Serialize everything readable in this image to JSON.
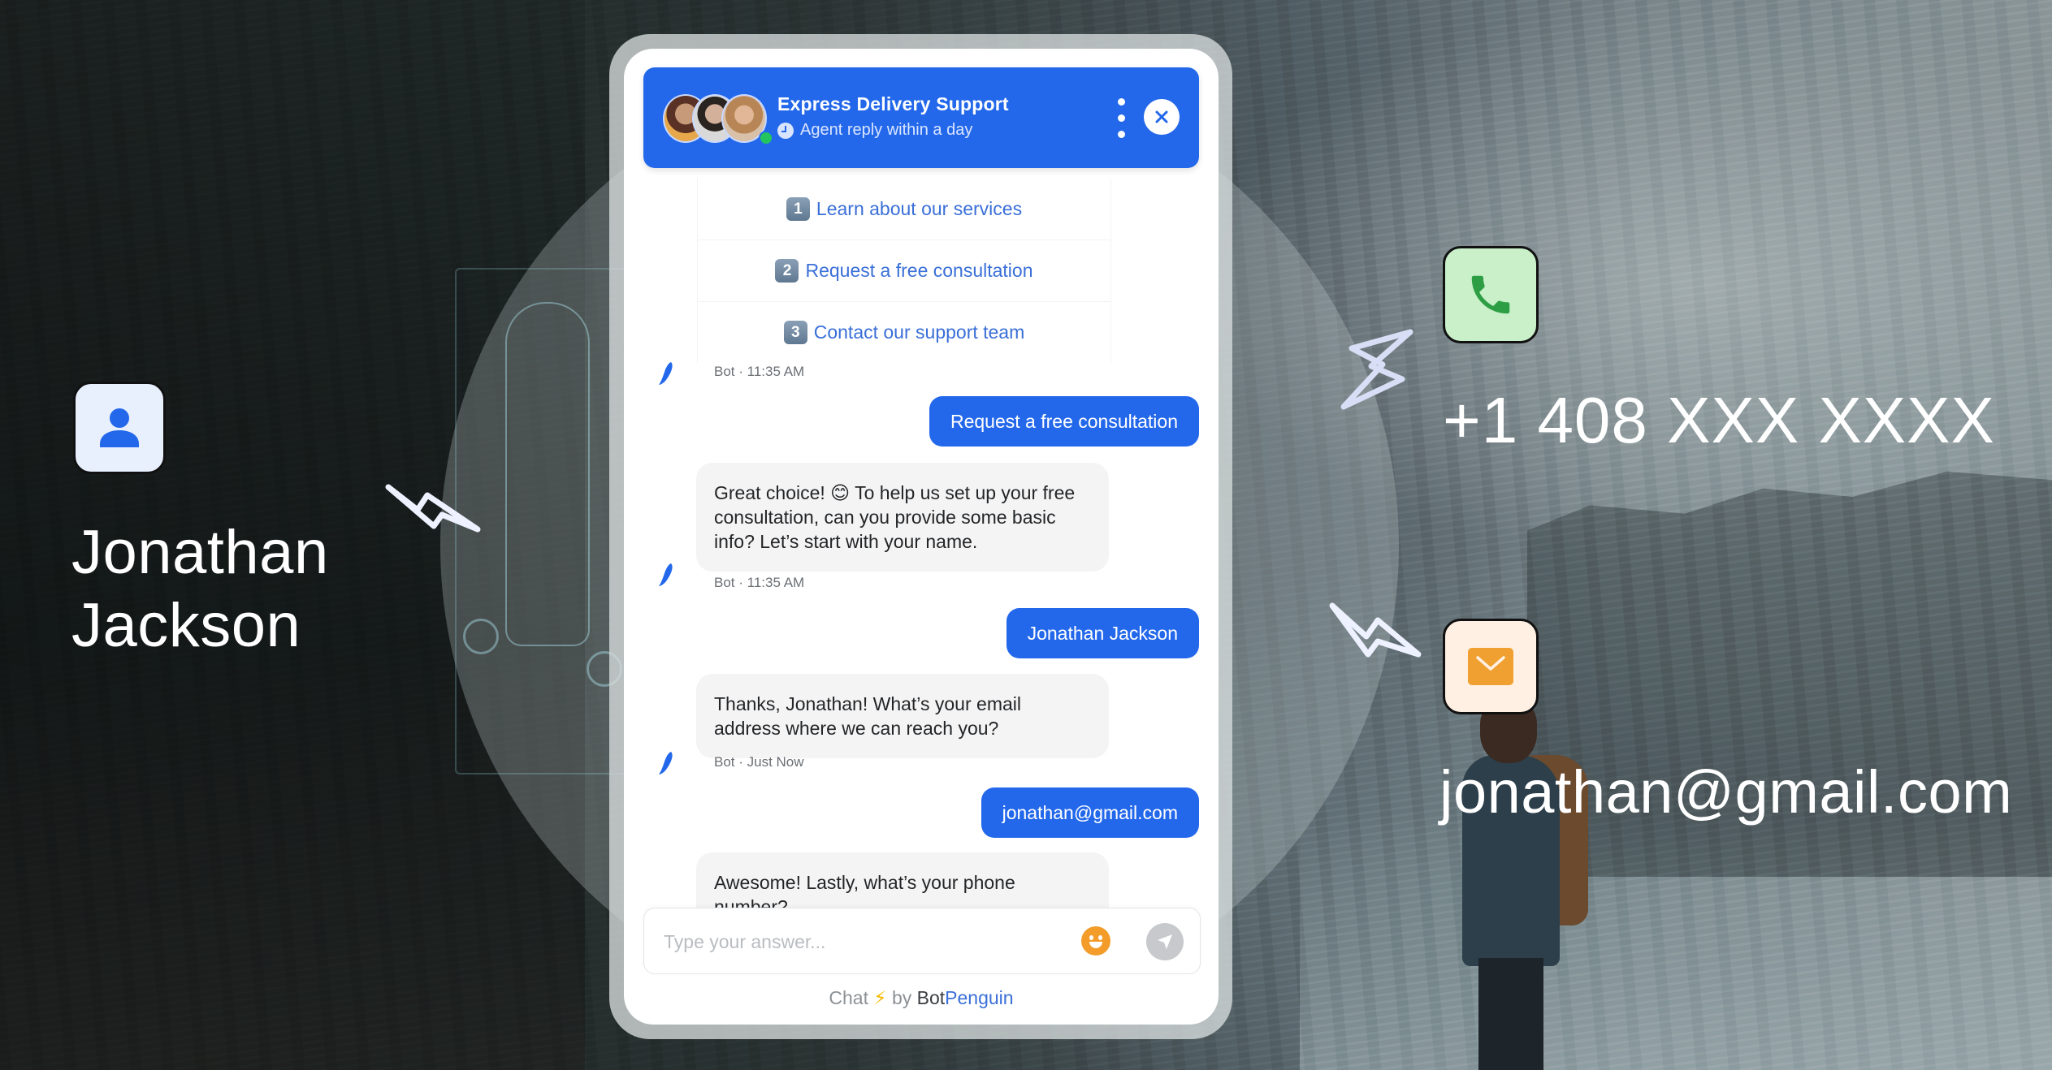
{
  "contact": {
    "name_line1": "Jonathan",
    "name_line2": "Jackson",
    "phone": "+1 408 XXX XXXX",
    "email": "jonathan@gmail.com",
    "icons": {
      "person": "person-icon",
      "phone": "phone-icon",
      "email": "envelope-icon"
    },
    "colors": {
      "person_box": "#e8f0fe",
      "person_icon": "#2368eb",
      "phone_box": "#c9f0c9",
      "phone_icon": "#2e9e44",
      "email_box": "#fff0e3",
      "email_icon": "#f0a030"
    }
  },
  "chat": {
    "header": {
      "title": "Express Delivery Support",
      "subtitle": "Agent reply within a day",
      "status": "online",
      "menu_icon": "kebab-menu-icon",
      "close_icon": "close-icon"
    },
    "options": [
      {
        "key": "1",
        "label": "Learn about our services"
      },
      {
        "key": "2",
        "label": "Request a free consultation"
      },
      {
        "key": "3",
        "label": "Contact our support team"
      }
    ],
    "messages": [
      {
        "from": "bot",
        "meta": "Bot · 11:35 AM",
        "type": "options"
      },
      {
        "from": "user",
        "text": "Request a free consultation"
      },
      {
        "from": "bot",
        "text": "Great choice! 😊 To help us set up your free consultation, can you provide some basic info? Let’s start with your name.",
        "meta": "Bot · 11:35 AM"
      },
      {
        "from": "user",
        "text": "Jonathan Jackson"
      },
      {
        "from": "bot",
        "text": "Thanks, Jonathan! What’s your email address where we can reach you?",
        "meta": "Bot · Just Now"
      },
      {
        "from": "user",
        "text": "jonathan@gmail.com"
      },
      {
        "from": "bot",
        "text": "Awesome! Lastly, what’s your phone number?"
      }
    ],
    "input": {
      "placeholder": "Type your answer...",
      "value": ""
    },
    "footer": {
      "prefix": "Chat",
      "by": "by",
      "brand_part1": "Bot",
      "brand_part2": "Penguin"
    },
    "colors": {
      "accent": "#2368eb",
      "bot_bubble": "#f4f4f5",
      "option_text": "#3a6fd8",
      "emoji": "#f39c2a",
      "send_disabled": "#c7c9cc"
    }
  }
}
